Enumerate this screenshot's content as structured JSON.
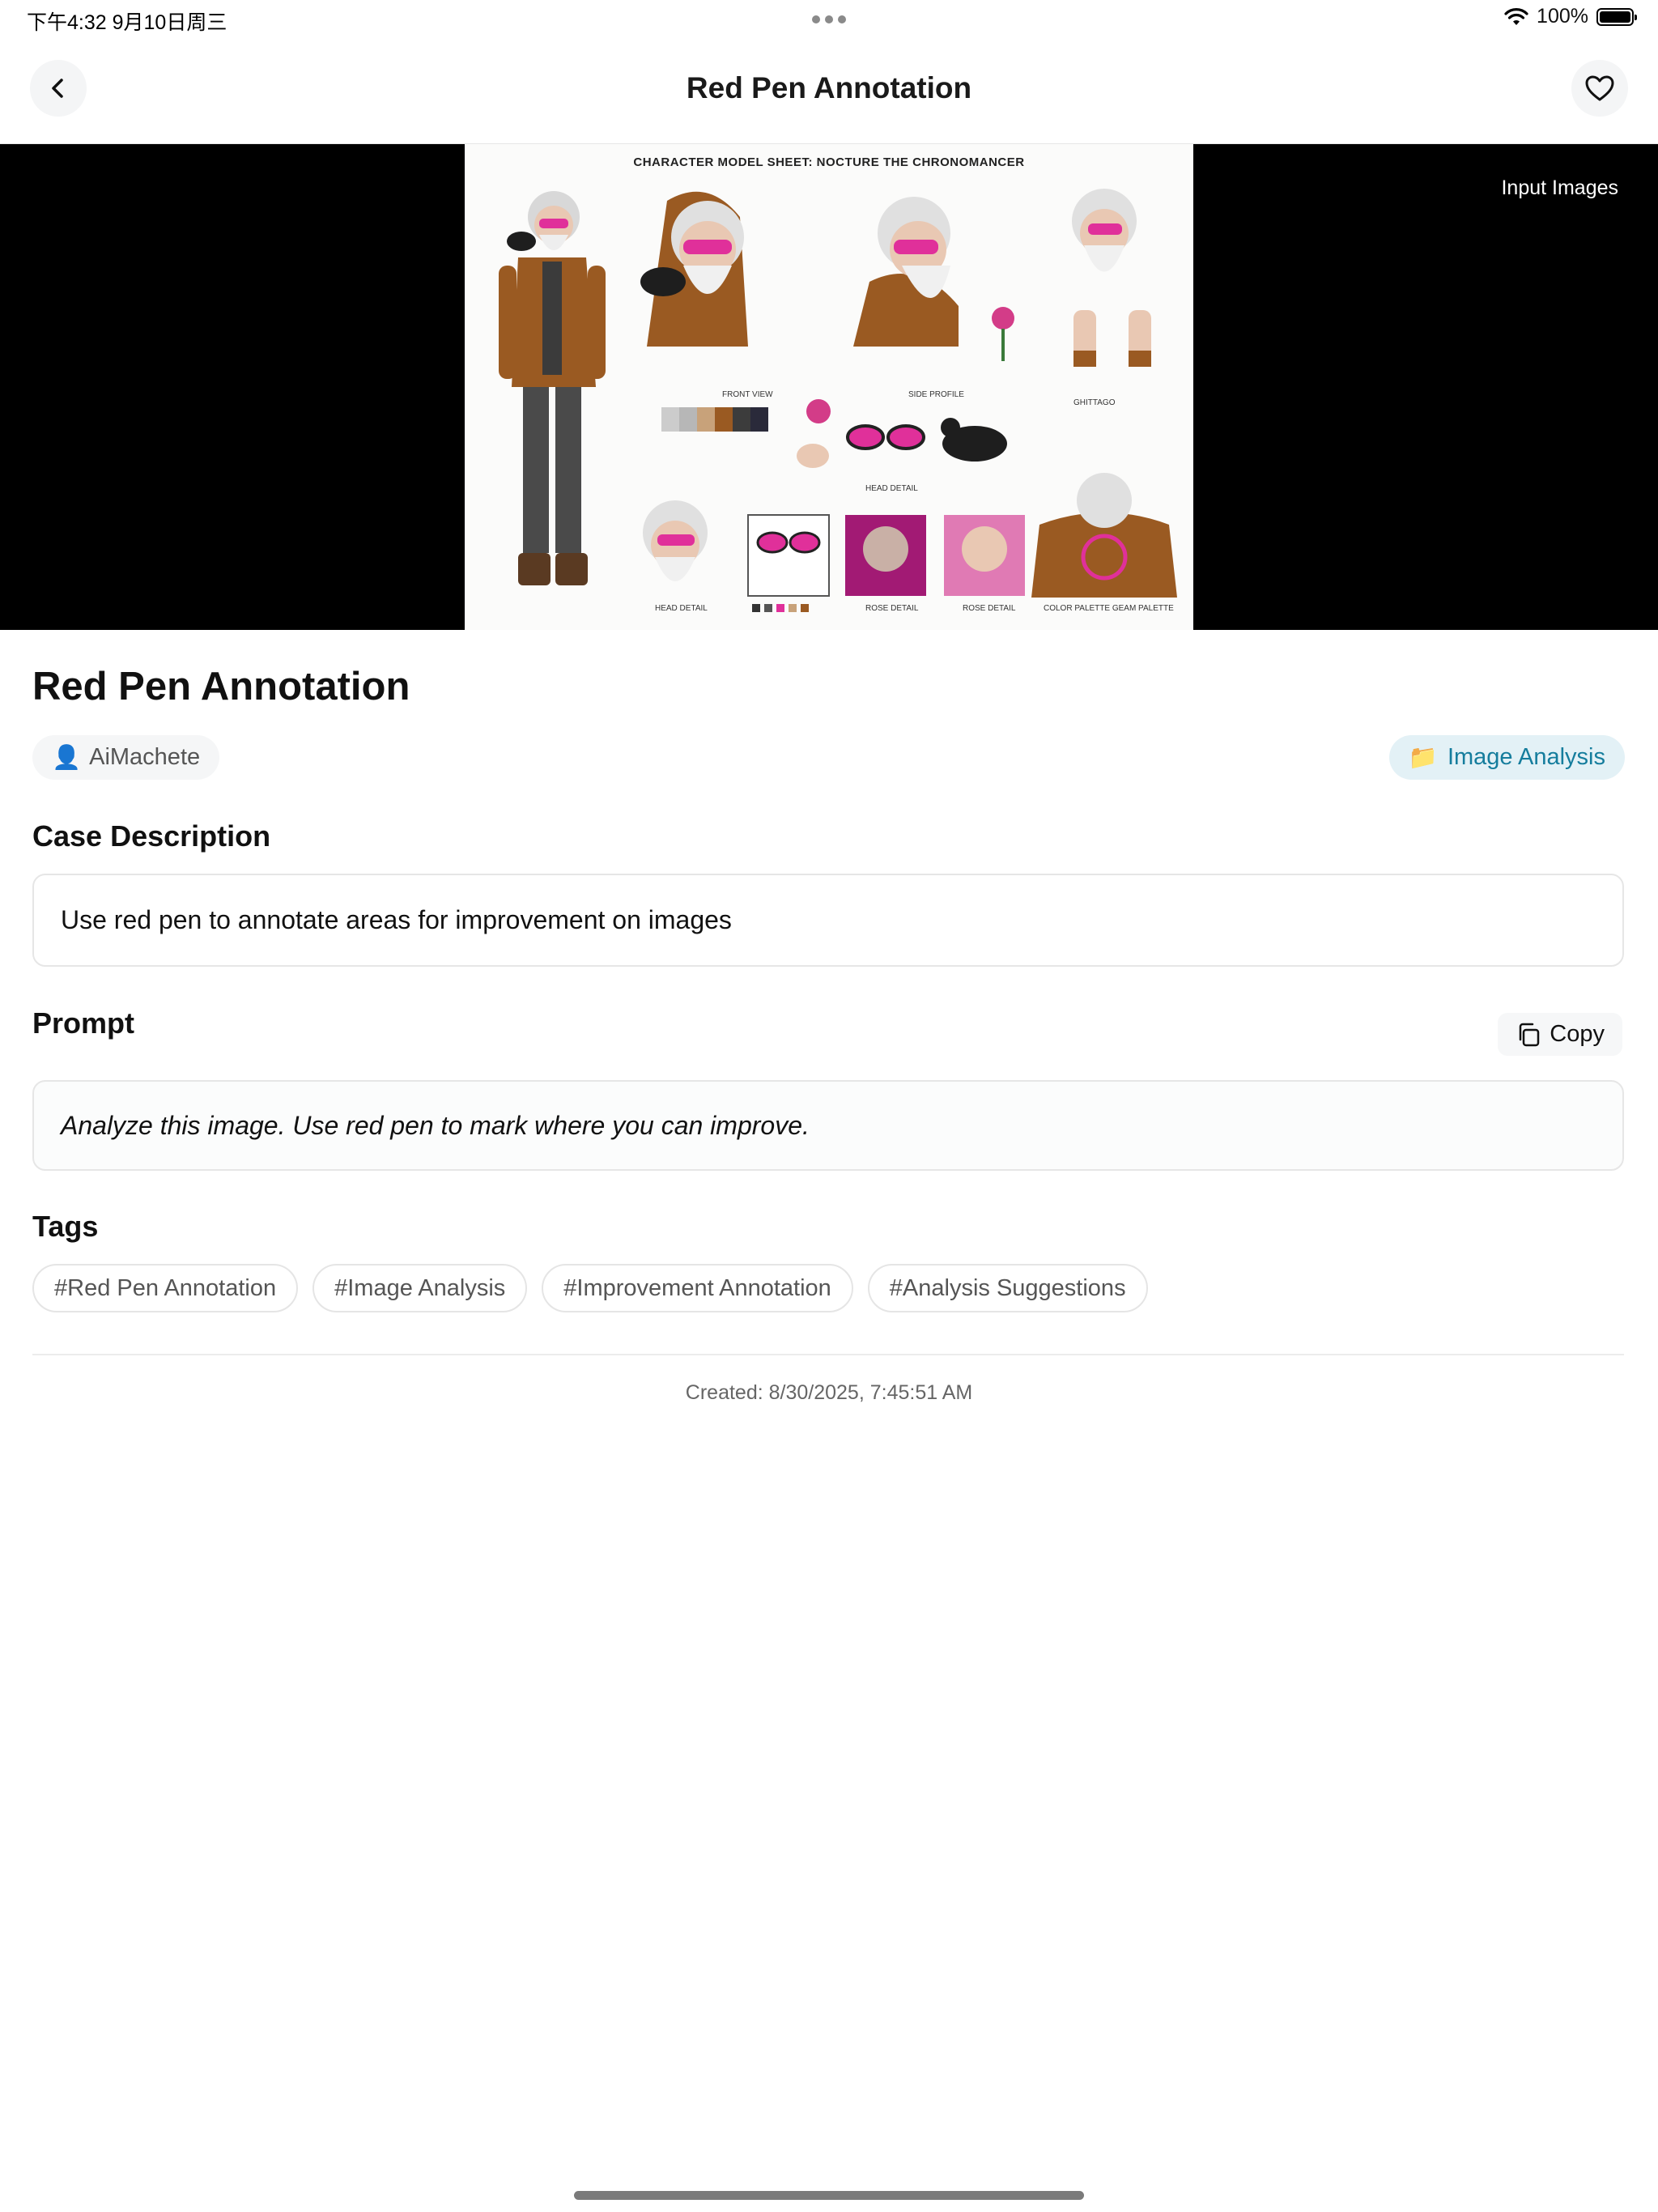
{
  "status_bar": {
    "time": "下午4:32   9月10日周三",
    "battery": "100%"
  },
  "nav": {
    "title": "Red Pen Annotation"
  },
  "hero": {
    "label": "Input Images",
    "sheet_title": "CHARACTER MODEL SHEET: NOCTURE THE CHRONOMANCER",
    "captions": [
      "FRONT VIEW",
      "SIDE PROFILE",
      "GHITTAGO",
      "HEAD DETAIL",
      "HEAD DETAIL",
      "ROSE DETAIL",
      "ROSE DETAIL",
      "COLOR PALETTE GEAM PALETTE"
    ]
  },
  "page": {
    "title": "Red Pen Annotation"
  },
  "author": {
    "icon": "👤",
    "name": "AiMachete"
  },
  "category": {
    "icon": "📁",
    "label": "Image Analysis"
  },
  "description": {
    "heading": "Case Description",
    "text": "Use red pen to annotate areas for improvement on images"
  },
  "prompt": {
    "heading": "Prompt",
    "copy_label": "Copy",
    "text": "Analyze this image. Use red pen to mark where you can improve."
  },
  "tags": {
    "heading": "Tags",
    "items": [
      "#Red Pen Annotation",
      "#Image Analysis",
      "#Improvement Annotation",
      "#Analysis Suggestions"
    ]
  },
  "created": "Created: 8/30/2025, 7:45:51 AM",
  "colors": {
    "accent": "#157d9d",
    "accent_bg": "#e3f1f6",
    "jacket": "#9a5a22",
    "pink": "#e0309a"
  }
}
